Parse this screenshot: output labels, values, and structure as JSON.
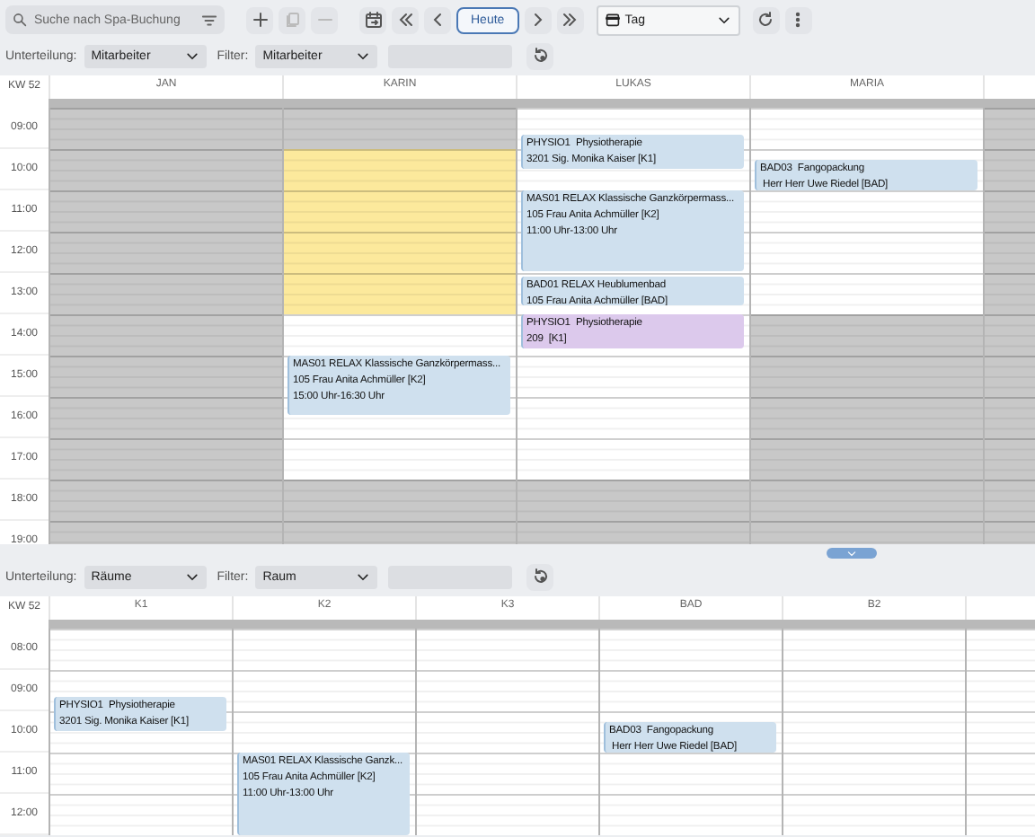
{
  "toolbar": [
    {
      "kind": "search",
      "placeholder": "Suche nach Spa-Buchung"
    },
    {
      "kind": "add",
      "disabled": false
    },
    {
      "kind": "copy",
      "disabled": true
    },
    {
      "kind": "remove",
      "disabled": true
    },
    {
      "kind": "goto-date",
      "disabled": false
    },
    {
      "kind": "first",
      "disabled": false
    },
    {
      "kind": "prev",
      "disabled": false
    },
    {
      "kind": "today",
      "label": "Heute"
    },
    {
      "kind": "next",
      "disabled": false
    },
    {
      "kind": "last",
      "disabled": false
    },
    {
      "kind": "view-select",
      "value": "Tag"
    },
    {
      "kind": "refresh",
      "disabled": false
    },
    {
      "kind": "more",
      "disabled": false
    }
  ],
  "panes": [
    {
      "division_label": "Unterteilung:",
      "division": "Mitarbeiter",
      "filter_label": "Filter:",
      "filter": "Mitarbeiter",
      "week": "KW 52",
      "hours": [
        "09:00",
        "10:00",
        "11:00",
        "12:00",
        "13:00",
        "14:00",
        "15:00",
        "16:00",
        "17:00",
        "18:00",
        "19:00"
      ],
      "columns": [
        {
          "name": "JAN"
        },
        {
          "name": "KARIN",
          "segments": [
            {
              "kind": "reserved"
            },
            {
              "kind": "free"
            }
          ],
          "events": [
            {
              "color": "#cfe0ee",
              "lines": [
                "MAS01 RELAX Klassische Ganzkörpermass...",
                "105 Frau Anita Achmüller [K2]",
                "15:00 Uhr-16:30 Uhr"
              ]
            }
          ]
        },
        {
          "name": "LUKAS",
          "segments": [
            {
              "kind": "free"
            }
          ],
          "events": [
            {
              "color": "#cfe0ee",
              "lines": [
                "PHYSIO1  Physiotherapie",
                "3201 Sig. Monika Kaiser [K1]"
              ]
            },
            {
              "color": "#cfe0ee",
              "lines": [
                "MAS01 RELAX Klassische Ganzkörpermass...",
                "105 Frau Anita Achmüller [K2]",
                "11:00 Uhr-13:00 Uhr"
              ]
            },
            {
              "color": "#cfe0ee",
              "lines": [
                "BAD01 RELAX Heublumenbad",
                "105 Frau Anita Achmüller [BAD]"
              ]
            },
            {
              "color": "#dcc9ec",
              "lines": [
                "PHYSIO1  Physiotherapie",
                "209  [K1]"
              ]
            }
          ]
        },
        {
          "name": "MARIA",
          "segments": [
            {
              "kind": "free"
            }
          ],
          "events": [
            {
              "color": "#cfe0ee",
              "lines": [
                "BAD03  Fangopackung",
                " Herr Herr Uwe Riedel [BAD]"
              ]
            }
          ]
        },
        {}
      ]
    },
    {
      "division_label": "Unterteilung:",
      "division": "Räume",
      "filter_label": "Filter:",
      "filter": "Raum",
      "week": "KW 52",
      "hours": [
        "08:00",
        "09:00",
        "10:00",
        "11:00",
        "12:00"
      ],
      "columns": [
        {
          "name": "K1",
          "segments": [
            {
              "kind": "free"
            }
          ],
          "events": [
            {
              "color": "#cfe0ee",
              "lines": [
                "PHYSIO1  Physiotherapie",
                "3201 Sig. Monika Kaiser [K1]"
              ]
            }
          ]
        },
        {
          "name": "K2",
          "segments": [
            {
              "kind": "free"
            }
          ],
          "events": [
            {
              "color": "#cfe0ee",
              "lines": [
                "MAS01 RELAX Klassische Ganzk...",
                "105 Frau Anita Achmüller [K2]",
                "11:00 Uhr-13:00 Uhr"
              ]
            }
          ]
        },
        {
          "name": "K3",
          "segments": [
            {
              "kind": "free"
            }
          ]
        },
        {
          "name": "BAD",
          "segments": [
            {
              "kind": "free"
            }
          ],
          "events": [
            {
              "color": "#cfe0ee",
              "lines": [
                "BAD03  Fangopackung",
                " Herr Herr Uwe Riedel [BAD]"
              ]
            }
          ]
        },
        {
          "name": "B2",
          "segments": [
            {
              "kind": "free"
            }
          ]
        },
        {
          "segments": [
            {
              "kind": "free"
            }
          ]
        }
      ]
    }
  ]
}
